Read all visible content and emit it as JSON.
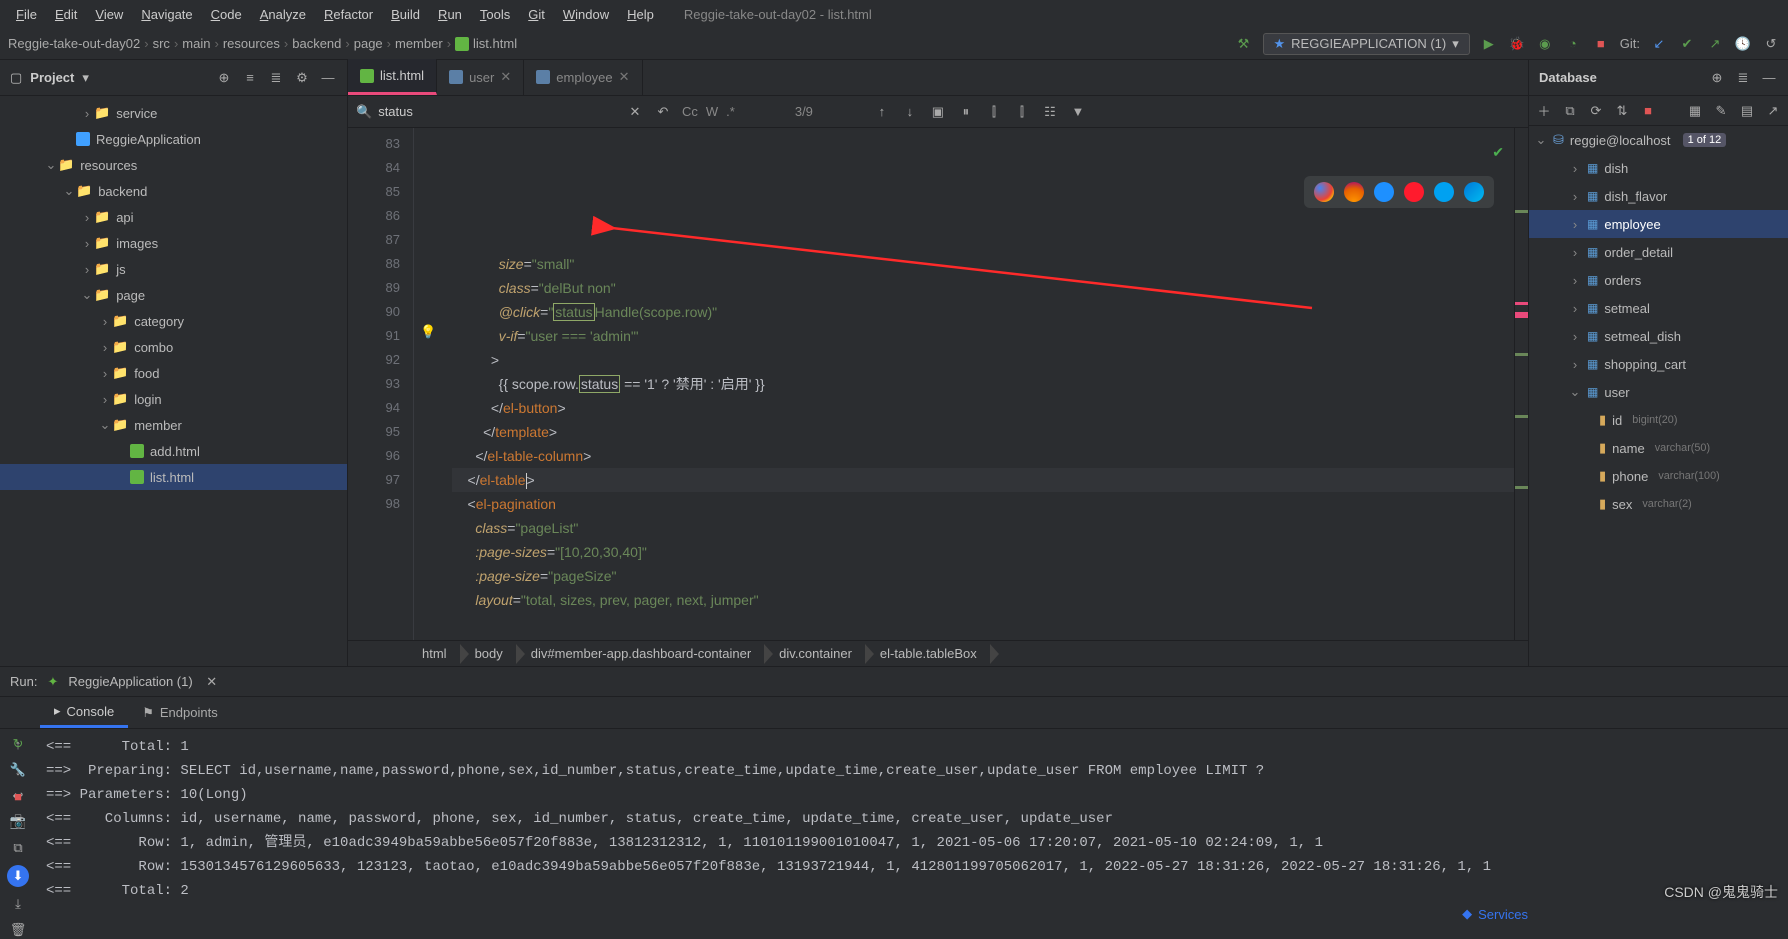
{
  "window_title": "Reggie-take-out-day02 - list.html",
  "menu": [
    "File",
    "Edit",
    "View",
    "Navigate",
    "Code",
    "Analyze",
    "Refactor",
    "Build",
    "Run",
    "Tools",
    "Git",
    "Window",
    "Help"
  ],
  "breadcrumb": [
    "Reggie-take-out-day02",
    "src",
    "main",
    "resources",
    "backend",
    "page",
    "member",
    "list.html"
  ],
  "run_config": "REGGIEAPPLICATION (1)",
  "git_label": "Git:",
  "project_panel_title": "Project",
  "project_tree": [
    {
      "depth": 4,
      "chev": "›",
      "kind": "folder",
      "label": "service"
    },
    {
      "depth": 3,
      "chev": "",
      "kind": "class",
      "label": "ReggieApplication"
    },
    {
      "depth": 2,
      "chev": "⌄",
      "kind": "folder",
      "label": "resources"
    },
    {
      "depth": 3,
      "chev": "⌄",
      "kind": "folder",
      "label": "backend"
    },
    {
      "depth": 4,
      "chev": "›",
      "kind": "folder",
      "label": "api"
    },
    {
      "depth": 4,
      "chev": "›",
      "kind": "folder",
      "label": "images"
    },
    {
      "depth": 4,
      "chev": "›",
      "kind": "folder",
      "label": "js"
    },
    {
      "depth": 4,
      "chev": "⌄",
      "kind": "folder",
      "label": "page"
    },
    {
      "depth": 5,
      "chev": "›",
      "kind": "folder",
      "label": "category"
    },
    {
      "depth": 5,
      "chev": "›",
      "kind": "folder",
      "label": "combo"
    },
    {
      "depth": 5,
      "chev": "›",
      "kind": "folder",
      "label": "food"
    },
    {
      "depth": 5,
      "chev": "›",
      "kind": "folder",
      "label": "login"
    },
    {
      "depth": 5,
      "chev": "⌄",
      "kind": "folder",
      "label": "member"
    },
    {
      "depth": 6,
      "chev": "",
      "kind": "html",
      "label": "add.html"
    },
    {
      "depth": 6,
      "chev": "",
      "kind": "html",
      "label": "list.html",
      "sel": true
    }
  ],
  "tabs": [
    {
      "label": "list.html",
      "icon": "html",
      "active": true
    },
    {
      "label": "user",
      "icon": "db",
      "close": true
    },
    {
      "label": "employee",
      "icon": "db",
      "close": true
    }
  ],
  "find_query": "status",
  "find_hits": "3/9",
  "find_opts": [
    "Cc",
    "W",
    ".*"
  ],
  "line_start": 83,
  "code_lines": [
    {
      "n": 83,
      "html": "            <span class='k-attr'>size</span>=<span class='k-str'>\"small\"</span>"
    },
    {
      "n": 84,
      "html": "            <span class='k-attr'>class</span>=<span class='k-str'>\"delBut non\"</span>"
    },
    {
      "n": 85,
      "html": "            <span class='k-attr'>@click</span>=<span class='k-str'>\"<span class='hl-box'>status</span>Handle(scope.row)\"</span>"
    },
    {
      "n": 86,
      "html": "            <span class='k-attr'>v-if</span>=<span class='k-str'>\"user === 'admin'\"</span>"
    },
    {
      "n": 87,
      "html": "          &gt;"
    },
    {
      "n": 88,
      "html": "            {{ scope.row.<span class='hl-box'>status</span> == '1' ? '禁用' : '启用' }}"
    },
    {
      "n": 89,
      "html": "          &lt;/<span class='k-tag'>el-button</span>&gt;"
    },
    {
      "n": 90,
      "html": "        &lt;/<span class='k-tag'>template</span>&gt;"
    },
    {
      "n": 91,
      "html": "      &lt;/<span class='k-tag'>el-table-column</span>&gt;"
    },
    {
      "n": 92,
      "html": "    &lt;/<span class='k-tag'>el-table</span><span class='caret'></span>&gt;",
      "cur": true
    },
    {
      "n": 93,
      "html": "    &lt;<span class='k-tag'>el-pagination</span>"
    },
    {
      "n": 94,
      "html": "      <span class='k-attr'>class</span>=<span class='k-str'>\"pageList\"</span>"
    },
    {
      "n": 95,
      "html": "      <span class='k-attr'>:page-sizes</span>=<span class='k-str'>\"[10,20,30,40]\"</span>"
    },
    {
      "n": 96,
      "html": "      <span class='k-attr'>:page-size</span>=<span class='k-str'>\"pageSize\"</span>"
    },
    {
      "n": 97,
      "html": "      <span class='k-attr'>layout</span>=<span class='k-str'>\"total, sizes, prev, pager, next, jumper\"</span>"
    },
    {
      "n": 98,
      "html": "      <span class='k-attr'></span>"
    }
  ],
  "crumbs": [
    "html",
    "body",
    "div#member-app.dashboard-container",
    "div.container",
    "el-table.tableBox"
  ],
  "db_panel_title": "Database",
  "db_conn": "reggie@localhost",
  "db_badge": "1 of 12",
  "db_tables": [
    {
      "label": "dish"
    },
    {
      "label": "dish_flavor"
    },
    {
      "label": "employee",
      "sel": true
    },
    {
      "label": "order_detail"
    },
    {
      "label": "orders"
    },
    {
      "label": "setmeal"
    },
    {
      "label": "setmeal_dish"
    },
    {
      "label": "shopping_cart"
    },
    {
      "label": "user",
      "open": true
    }
  ],
  "db_cols": [
    {
      "name": "id",
      "type": "bigint(20)"
    },
    {
      "name": "name",
      "type": "varchar(50)"
    },
    {
      "name": "phone",
      "type": "varchar(100)"
    },
    {
      "name": "sex",
      "type": "varchar(2)"
    }
  ],
  "run_title": "Run:",
  "run_cfg": "ReggieApplication (1)",
  "run_tabs": [
    {
      "label": "Console",
      "active": true
    },
    {
      "label": "Endpoints"
    }
  ],
  "console_lines": [
    "<==      Total: 1",
    "==>  Preparing: SELECT id,username,name,password,phone,sex,id_number,status,create_time,update_time,create_user,update_user FROM employee LIMIT ?",
    "==> Parameters: 10(Long)",
    "<==    Columns: id, username, name, password, phone, sex, id_number, status, create_time, update_time, create_user, update_user",
    "<==        Row: 1, admin, 管理员, e10adc3949ba59abbe56e057f20f883e, 13812312312, 1, 110101199001010047, 1, 2021-05-06 17:20:07, 2021-05-10 02:24:09, 1, 1",
    "<==        Row: 1530134576129605633, 123123, taotao, e10adc3949ba59abbe56e057f20f883e, 13193721944, 1, 412801199705062017, 1, 2022-05-27 18:31:26, 2022-05-27 18:31:26, 1, 1",
    "<==      Total: 2"
  ],
  "services_label": "Services",
  "watermark": "CSDN @鬼鬼骑士"
}
